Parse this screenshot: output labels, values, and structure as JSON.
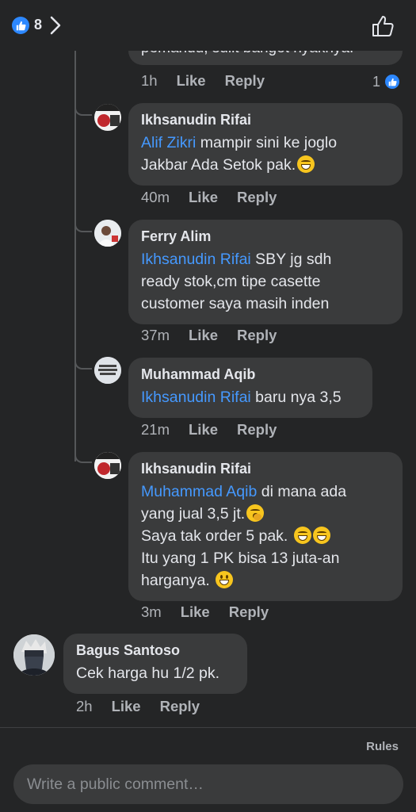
{
  "header": {
    "like_count": "8"
  },
  "top_comment": {
    "partial_text": "pemandu, sulit banget nyaknya.",
    "time": "1h",
    "like_label": "Like",
    "reply_label": "Reply",
    "reaction_count": "1"
  },
  "replies": [
    {
      "name": "Ikhsanudin Rifai",
      "mention": "Alif Zikri",
      "lines": [
        "mampir sini ke joglo",
        "Jakbar Ada Setok pak."
      ],
      "time": "40m",
      "like_label": "Like",
      "reply_label": "Reply"
    },
    {
      "name": "Ferry Alim",
      "mention": "Ikhsanudin Rifai",
      "lines": [
        "SBY jg sdh",
        "ready stok,cm tipe casette",
        "customer saya masih inden"
      ],
      "time": "37m",
      "like_label": "Like",
      "reply_label": "Reply"
    },
    {
      "name": "Muhammad Aqib",
      "mention": "Ikhsanudin Rifai",
      "lines": [
        "baru nya 3,5"
      ],
      "time": "21m",
      "like_label": "Like",
      "reply_label": "Reply"
    },
    {
      "name": "Ikhsanudin Rifai",
      "mention": "Muhammad Aqib",
      "lines": [
        "di mana ada",
        "yang jual 3,5 jt.",
        "Saya tak order 5 pak.",
        "Itu yang 1 PK bisa 13 juta-an",
        "harganya."
      ],
      "time": "3m",
      "like_label": "Like",
      "reply_label": "Reply"
    }
  ],
  "comment": {
    "name": "Bagus Santoso",
    "text": "Cek harga hu 1/2 pk.",
    "time": "2h",
    "like_label": "Like",
    "reply_label": "Reply"
  },
  "footer": {
    "rules_label": "Rules",
    "composer_placeholder": "Write a public comment…"
  },
  "colors": {
    "background": "#242526",
    "bubble": "#3a3b3c",
    "mention": "#4599ff",
    "like_blue": "#2d88ff",
    "secondary_text": "#b0b3b8"
  }
}
